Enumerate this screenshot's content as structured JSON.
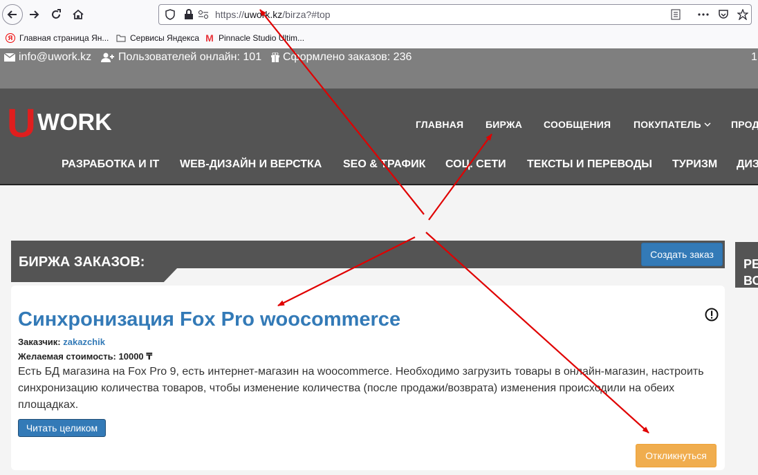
{
  "browser": {
    "url_prefix": "https://",
    "url_domain": "uwork.kz",
    "url_path": "/birza?#top",
    "bookmarks": [
      {
        "label": "Главная страница Ян...",
        "icon": "yandex-icon"
      },
      {
        "label": "Сервисы Яндекса",
        "icon": "folder-icon"
      },
      {
        "label": "Pinnacle Studio Ultim...",
        "icon": "pinnacle-icon"
      }
    ]
  },
  "topbar": {
    "email": "info@uwork.kz",
    "users_online": "Пользователей онлайн: 101",
    "orders": "Сформлено заказов: 236",
    "right_char": "1"
  },
  "logo": {
    "u": "U",
    "rest": "WORK"
  },
  "main_nav": [
    "ГЛАВНАЯ",
    "БИРЖА",
    "СООБЩЕНИЯ",
    "ПОКУПАТЕЛЬ",
    "ПРОД"
  ],
  "categories": [
    "РАЗРАБОТКА И IT",
    "WEB-ДИЗАЙН И ВЕРСТКА",
    "SEO & ТРАФИК",
    "СОЦ. СЕТИ",
    "ТЕКСТЫ И ПЕРЕВОДЫ",
    "ТУРИЗМ",
    "ДИЗ"
  ],
  "exchange": {
    "title": "БИРЖА ЗАКАЗОВ:",
    "create_button": "Создать заказ"
  },
  "order": {
    "title": "Синхронизация Fox Pro woocommerce",
    "customer_label": "Заказчик:",
    "customer_name": "zakazchik",
    "price_label": "Желаемая стоимость: 10000 ₸",
    "description": "Есть БД магазина на Fox Pro 9, есть интернет-магазин на woocommerce. Необходимо загрузить товары в онлайн-магазин, настроить синхронизацию количества товаров, чтобы изменение количества (после продажи/возврата) изменения происходили на обеих площадках.",
    "read_button": "Читать целиком",
    "respond_button": "Откликнуться"
  },
  "sidebar": {
    "line1": "РЕ",
    "line2": "ВО"
  },
  "colors": {
    "accent": "#337ab7",
    "header": "#545454",
    "respond": "#f0ad4e",
    "annotation": "#e00000"
  }
}
